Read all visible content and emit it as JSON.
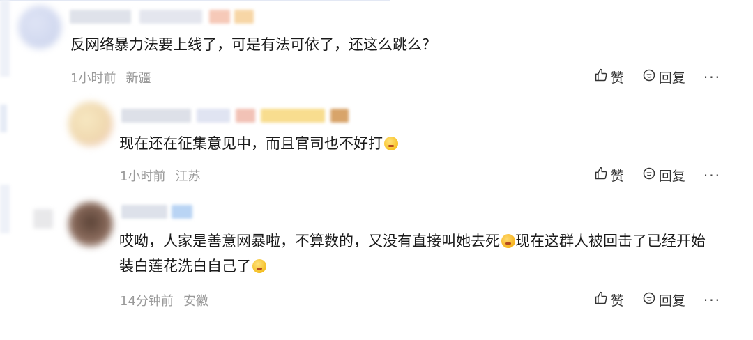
{
  "comments": [
    {
      "text": "反网络暴力法要上线了，可是有法可依了，还这么跳么？",
      "time": "1小时前",
      "location": "新疆",
      "like_label": "赞",
      "reply_label": "回复",
      "more_label": "···"
    },
    {
      "text": "现在还在征集意见中，而且官司也不好打",
      "emoji": "dizzy-face-emoji",
      "time": "1小时前",
      "location": "江苏",
      "like_label": "赞",
      "reply_label": "回复",
      "more_label": "···"
    },
    {
      "text_line1": "哎呦，人家是善意网暴啦，不算数的，又没有直接叫她去死",
      "text_line1_after": "现在这群人被回击了已经开始",
      "text_line2": "装白莲花洗白自己了",
      "emoji1": "winking-tongue-emoji",
      "emoji2": "thinking-face-emoji",
      "time": "14分钟前",
      "location": "安徽",
      "like_label": "赞",
      "reply_label": "回复",
      "more_label": "···"
    }
  ],
  "colors": {
    "text": "#1a1a1a",
    "meta": "#9a9a9a",
    "action": "#333333"
  }
}
